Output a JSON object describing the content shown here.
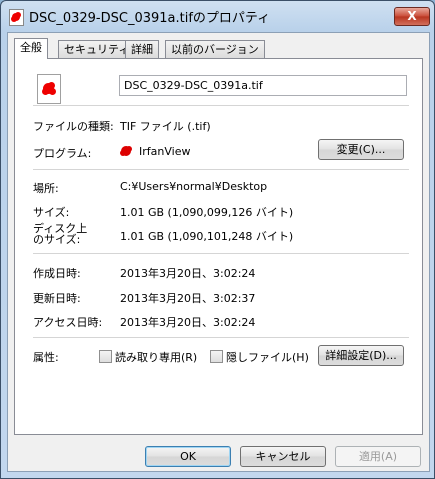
{
  "window": {
    "title": "DSC_0329-DSC_0391a.tifのプロパティ",
    "close_label": "X"
  },
  "tabs": [
    {
      "label": "全般",
      "active": true
    },
    {
      "label": "セキュリティ"
    },
    {
      "label": "詳細"
    },
    {
      "label": "以前のバージョン"
    }
  ],
  "general": {
    "file_name": "DSC_0329-DSC_0391a.tif",
    "file_type_label": "ファイルの種類:",
    "file_type_value": "TIF ファイル (.tif)",
    "program_label": "プログラム:",
    "program_value": "IrfanView",
    "change_button": "変更(C)...",
    "location_label": "場所:",
    "location_value": "C:¥Users¥normal¥Desktop",
    "size_label": "サイズ:",
    "size_value": "1.01 GB (1,090,099,126 バイト)",
    "disk_size_label_1": "ディスク上",
    "disk_size_label_2": "のサイズ:",
    "disk_size_value": "1.01 GB (1,090,101,248 バイト)",
    "created_label": "作成日時:",
    "created_value": "2013年3月20日、3:02:24",
    "modified_label": "更新日時:",
    "modified_value": "2013年3月20日、3:02:37",
    "accessed_label": "アクセス日時:",
    "accessed_value": "2013年3月20日、3:02:24",
    "attributes_label": "属性:",
    "readonly_label": "読み取り専用(R)",
    "hidden_label": "隠しファイル(H)",
    "advanced_button": "詳細設定(D)..."
  },
  "footer": {
    "ok": "OK",
    "cancel": "キャンセル",
    "apply": "適用(A)"
  }
}
